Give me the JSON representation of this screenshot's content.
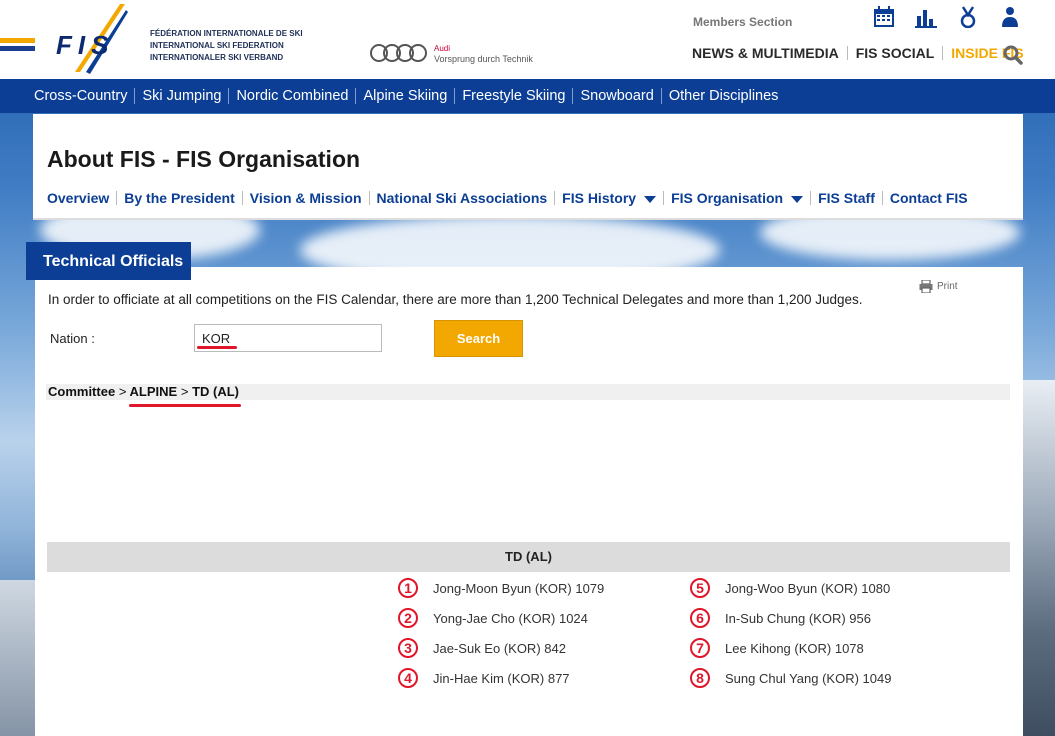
{
  "header": {
    "logo_text": "FIS",
    "federation_lines": [
      "FÉDÉRATION INTERNATIONALE DE SKI",
      "INTERNATIONAL SKI FEDERATION",
      "INTERNATIONALER SKI VERBAND"
    ],
    "sponsor_brand": "Audi",
    "sponsor_tagline": "Vorsprung durch Technik",
    "members_section": "Members Section",
    "icons": [
      "calendar-icon",
      "results-chart-icon",
      "medal-icon",
      "athlete-icon"
    ],
    "nav": [
      {
        "label": "NEWS & MULTIMEDIA",
        "active": false
      },
      {
        "label": "FIS SOCIAL",
        "active": false
      },
      {
        "label": "INSIDE FIS",
        "active": true
      }
    ]
  },
  "discipline_nav": [
    "Cross-Country",
    "Ski Jumping",
    "Nordic Combined",
    "Alpine Skiing",
    "Freestyle Skiing",
    "Snowboard",
    "Other Disciplines"
  ],
  "about": {
    "title": "About FIS - FIS Organisation",
    "subnav": [
      {
        "label": "Overview",
        "dropdown": false
      },
      {
        "label": "By the President",
        "dropdown": false
      },
      {
        "label": "Vision & Mission",
        "dropdown": false
      },
      {
        "label": "National Ski Associations",
        "dropdown": false
      },
      {
        "label": "FIS History",
        "dropdown": true
      },
      {
        "label": "FIS Organisation",
        "dropdown": true
      },
      {
        "label": "FIS Staff",
        "dropdown": false
      },
      {
        "label": "Contact FIS",
        "dropdown": false
      }
    ]
  },
  "officials": {
    "tab_title": "Technical Officials",
    "print_label": "Print",
    "intro": "In order to officiate at all competitions on the FIS Calendar, there are more than 1,200 Technical Delegates and more than 1,200 Judges.",
    "nation_label": "Nation :",
    "nation_value": "KOR",
    "search_label": "Search",
    "breadcrumb": {
      "committee": "Committee",
      "sep": ">",
      "alpine": "ALPINE",
      "td": "TD (AL)"
    },
    "list_header": "TD (AL)",
    "people": [
      {
        "num": "1",
        "name": "Jong-Moon Byun (KOR) 1079"
      },
      {
        "num": "2",
        "name": "Yong-Jae Cho (KOR) 1024"
      },
      {
        "num": "3",
        "name": "Jae-Suk Eo (KOR) 842"
      },
      {
        "num": "4",
        "name": "Jin-Hae Kim (KOR) 877"
      },
      {
        "num": "5",
        "name": "Jong-Woo Byun (KOR) 1080"
      },
      {
        "num": "6",
        "name": "In-Sub Chung (KOR) 956"
      },
      {
        "num": "7",
        "name": "Lee Kihong (KOR) 1078"
      },
      {
        "num": "8",
        "name": "Sung Chul Yang (KOR) 1049"
      }
    ]
  },
  "colors": {
    "brand_blue": "#0b3e94",
    "accent_yellow": "#f2a800",
    "annotation_red": "#e0162b"
  }
}
